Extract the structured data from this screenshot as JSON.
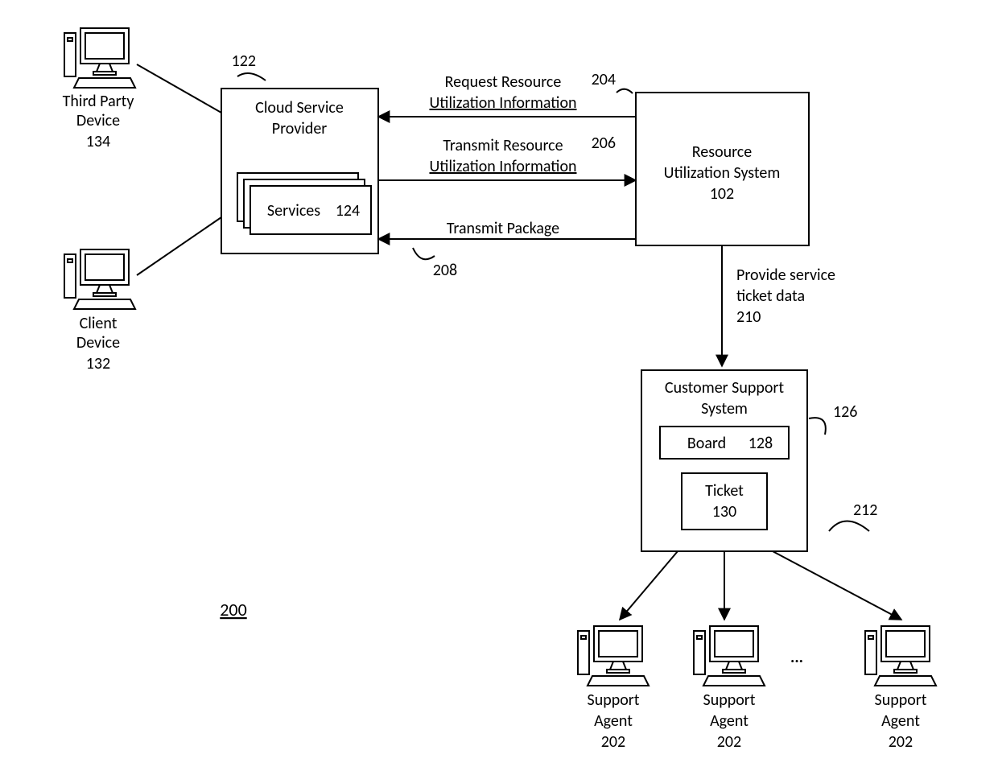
{
  "figure_ref": "200",
  "nodes": {
    "third_party": {
      "line1": "Third Party",
      "line2": "Device",
      "ref": "134"
    },
    "client": {
      "line1": "Client",
      "line2": "Device",
      "ref": "132"
    },
    "csp": {
      "title": "Cloud Service Provider",
      "ref": "122",
      "services_label": "Services",
      "services_ref": "124"
    },
    "rus": {
      "line1": "Resource",
      "line2": "Utilization System",
      "ref": "102"
    },
    "css": {
      "line1": "Customer Support",
      "line2": "System",
      "ref": "126",
      "board_label": "Board",
      "board_ref": "128",
      "ticket_label": "Ticket",
      "ticket_ref": "130"
    },
    "agent": {
      "line1": "Support",
      "line2": "Agent",
      "ref": "202"
    }
  },
  "edges": {
    "req": {
      "line1": "Request Resource",
      "line2": "Utilization Information",
      "ref": "204"
    },
    "trans_info": {
      "line1": "Transmit Resource",
      "line2": "Utilization Information",
      "ref": "206"
    },
    "trans_pkg": {
      "label": "Transmit Package",
      "ref": "208"
    },
    "provide": {
      "line1": "Provide service",
      "line2": "ticket data",
      "ref": "210"
    },
    "agents_ref": "212"
  },
  "misc": {
    "ellipsis": "..."
  }
}
